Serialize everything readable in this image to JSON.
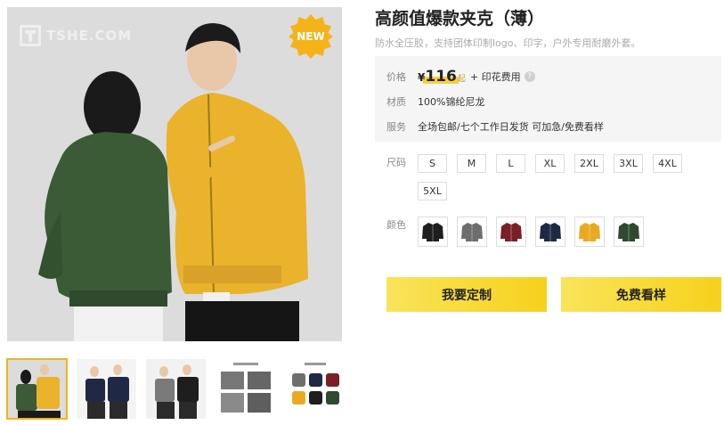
{
  "gallery": {
    "watermark": "TSHE.COM",
    "badge": "NEW",
    "thumbnails": [
      {
        "name": "thumb-green-yellow",
        "active": true
      },
      {
        "name": "thumb-navy-couple",
        "active": false
      },
      {
        "name": "thumb-grey-black-couple",
        "active": false
      },
      {
        "name": "thumb-detail-shots",
        "active": false
      },
      {
        "name": "thumb-color-grid",
        "active": false
      }
    ]
  },
  "product": {
    "title": "高颜值爆款夹克（薄）",
    "subtitle": "防水全压胶，支持团体印制logo、印字，户外专用耐磨外套。"
  },
  "info": {
    "price_label": "价格",
    "price_currency": "¥",
    "price_value": "116",
    "price_unit": "起",
    "price_extra": "+ 印花费用",
    "help_icon": "?",
    "material_label": "材质",
    "material_value": "100%锦纶尼龙",
    "service_label": "服务",
    "service_value": "全场包邮/七个工作日发货 可加急/免费看样"
  },
  "sizes": {
    "label": "尺码",
    "options": [
      "S",
      "M",
      "L",
      "XL",
      "2XL",
      "3XL",
      "4XL",
      "5XL"
    ]
  },
  "colors": {
    "label": "颜色",
    "swatches": [
      {
        "name": "black",
        "hex": "#1e1e1e"
      },
      {
        "name": "grey",
        "hex": "#6e6e6e"
      },
      {
        "name": "burgundy",
        "hex": "#7a1f28"
      },
      {
        "name": "navy",
        "hex": "#1f2844"
      },
      {
        "name": "yellow",
        "hex": "#e9aa22"
      },
      {
        "name": "green",
        "hex": "#2f4a2f"
      }
    ]
  },
  "actions": {
    "customize": "我要定制",
    "free_sample": "免费看样"
  }
}
